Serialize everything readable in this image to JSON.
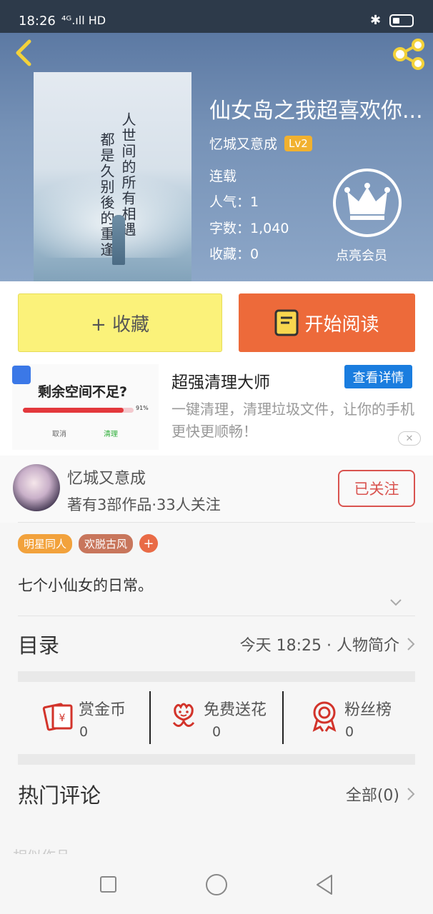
{
  "status": {
    "time": "18:26",
    "network": "⁴ᴳ.ıll HD"
  },
  "book": {
    "title": "仙女岛之我超喜欢你...",
    "author": "忆城又意成",
    "level": "Lv2",
    "status": "连载",
    "popularity_label": "人气：",
    "popularity": "1",
    "words_label": "字数：",
    "words": "1,040",
    "favorites_label": "收藏：",
    "favorites": "0",
    "vip_label": "点亮会员",
    "cover_lines": [
      "人世间的所有相遇",
      "都是久别後的重逢"
    ]
  },
  "actions": {
    "favorite": "+ 收藏",
    "read": "开始阅读"
  },
  "ad": {
    "thumb_title": "剩余空间不足?",
    "thumb_pct": "91%",
    "thumb_pct_value": 0.91,
    "thumb_cancel": "取消",
    "thumb_clean": "清理",
    "title": "超强清理大师",
    "desc": "一键清理，清理垃圾文件，让你的手机更快更顺畅！",
    "cta": "查看详情",
    "close": "✕"
  },
  "author_block": {
    "name": "忆城又意成",
    "sub": "著有3部作品·33人关注",
    "follow": "已关注"
  },
  "tags": [
    {
      "label": "明星同人",
      "color": "#f2a23c"
    },
    {
      "label": "欢脱古风",
      "color": "#c8765c"
    }
  ],
  "tag_add": "+",
  "description": "七个小仙女的日常。",
  "toc": {
    "label": "目录",
    "info": "今天 18:25 · 人物简介"
  },
  "stats": [
    {
      "label": "赏金币",
      "value": "0",
      "icon": "coin-envelope-icon"
    },
    {
      "label": "免费送花",
      "value": "0",
      "icon": "flower-icon"
    },
    {
      "label": "粉丝榜",
      "value": "0",
      "icon": "medal-icon"
    }
  ],
  "comments": {
    "label": "热门评论",
    "all": "全部(0)"
  },
  "similar": {
    "label": "相似作品"
  },
  "colors": {
    "accent_orange": "#ed6a3a",
    "fav_yellow": "#fbf27a",
    "ad_blue": "#1a7ddf",
    "follow_red": "#d9534f"
  }
}
